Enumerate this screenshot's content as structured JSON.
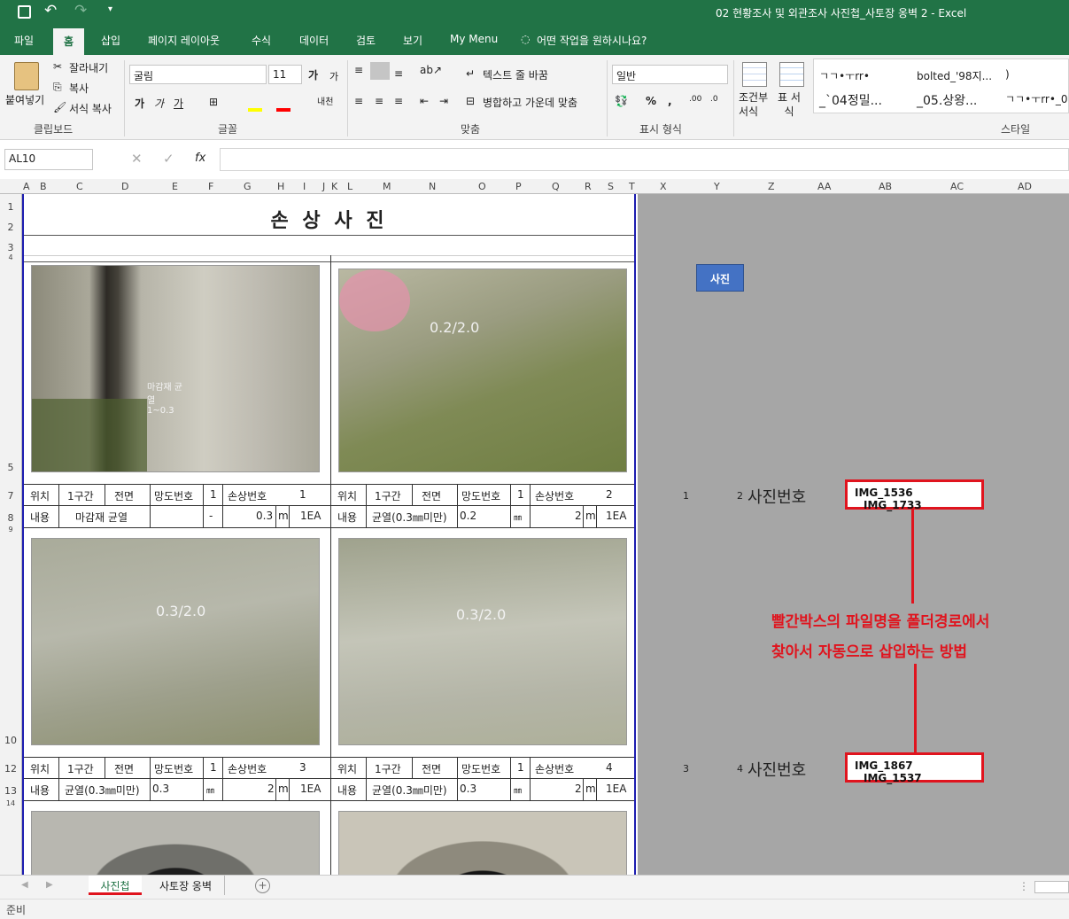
{
  "window": {
    "title": "02 현황조사 및 외관조사 사진첩_사토장 옹벽 2  -  Excel"
  },
  "ribbon_tabs": [
    "파일",
    "홈",
    "삽입",
    "페이지 레이아웃",
    "수식",
    "데이터",
    "검토",
    "보기",
    "My Menu",
    "어떤 작업을 원하시나요?"
  ],
  "clipboard": {
    "paste": "붙여넣기",
    "cut": "잘라내기",
    "copy": "복사",
    "format_painter": "서식 복사",
    "label": "클립보드"
  },
  "font": {
    "name": "굴림",
    "size": "11",
    "label": "글꼴"
  },
  "alignment": {
    "wrap": "텍스트 줄 바꿈",
    "merge": "병합하고 가운데 맞춤",
    "label": "맞춤"
  },
  "number": {
    "format": "일반",
    "label": "표시 형식"
  },
  "styles": {
    "cond": "조건부 서식",
    "table": "표 서식",
    "label": "스타일",
    "gallery": [
      "ㄱㄱ•ㅜrr•",
      "bolted_'98지...",
      ")",
      "_`04정밀...",
      "_05.상왕...",
      "ㄱㄱ•ㅜrr•_0"
    ]
  },
  "formula_bar": {
    "name_box": "AL10",
    "fx": "fx"
  },
  "columns": [
    "A",
    "B",
    "C",
    "D",
    "E",
    "F",
    "G",
    "H",
    "I",
    "J",
    "K",
    "L",
    "M",
    "N",
    "O",
    "P",
    "Q",
    "R",
    "S",
    "T",
    "X",
    "Y",
    "Z",
    "AA",
    "AB",
    "AC",
    "AD"
  ],
  "rows": [
    "1",
    "2",
    "3",
    "4",
    "5",
    "7",
    "8",
    "9",
    "10",
    "12",
    "13",
    "14"
  ],
  "sheet": {
    "title": "손 상 사 진",
    "records": [
      {
        "loc_label": "위치",
        "loc": "1구간",
        "face": "전면",
        "net_label": "망도번호",
        "net": "1",
        "dmg_label": "손상번호",
        "dmg": "1",
        "content_label": "내용",
        "content": "마감재 균열",
        "width": "",
        "dash": "-",
        "len": "0.3",
        "unit": "m",
        "qty": "1EA"
      },
      {
        "loc_label": "위치",
        "loc": "1구간",
        "face": "전면",
        "net_label": "망도번호",
        "net": "1",
        "dmg_label": "손상번호",
        "dmg": "2",
        "content_label": "내용",
        "content": "균열(0.3㎜미만)",
        "width": "0.2",
        "dash": "㎜",
        "len": "2",
        "unit": "m",
        "qty": "1EA"
      },
      {
        "loc_label": "위치",
        "loc": "1구간",
        "face": "전면",
        "net_label": "망도번호",
        "net": "1",
        "dmg_label": "손상번호",
        "dmg": "3",
        "content_label": "내용",
        "content": "균열(0.3㎜미만)",
        "width": "0.3",
        "dash": "㎜",
        "len": "2",
        "unit": "m",
        "qty": "1EA"
      },
      {
        "loc_label": "위치",
        "loc": "1구간",
        "face": "전면",
        "net_label": "망도번호",
        "net": "1",
        "dmg_label": "손상번호",
        "dmg": "4",
        "content_label": "내용",
        "content": "균열(0.3㎜미만)",
        "width": "0.3",
        "dash": "㎜",
        "len": "2",
        "unit": "m",
        "qty": "1EA"
      }
    ],
    "photo_marks": [
      "마감재 균열 1~0.3",
      "0.2/2.0",
      "0.3/2.0",
      "0.3/2.0"
    ]
  },
  "side": {
    "button": "사진",
    "row1": {
      "a": "1",
      "b": "2",
      "label": "사진번호",
      "img1": "IMG_1536",
      "img2": "IMG_1733"
    },
    "row2": {
      "a": "3",
      "b": "4",
      "label": "사진번호",
      "img1": "IMG_1867",
      "img2": "IMG_1537"
    },
    "note1": "빨간박스의 파일명을 폴더경로에서",
    "note2": "찾아서 자동으로 삽입하는 방법"
  },
  "sheet_tabs": [
    "사진첩",
    "사토장 옹벽"
  ],
  "status": "준비",
  "colors": {
    "excel_green": "#217346",
    "red": "#e0141e",
    "blue_border": "#1c1cb0",
    "button_blue": "#4472c4"
  }
}
